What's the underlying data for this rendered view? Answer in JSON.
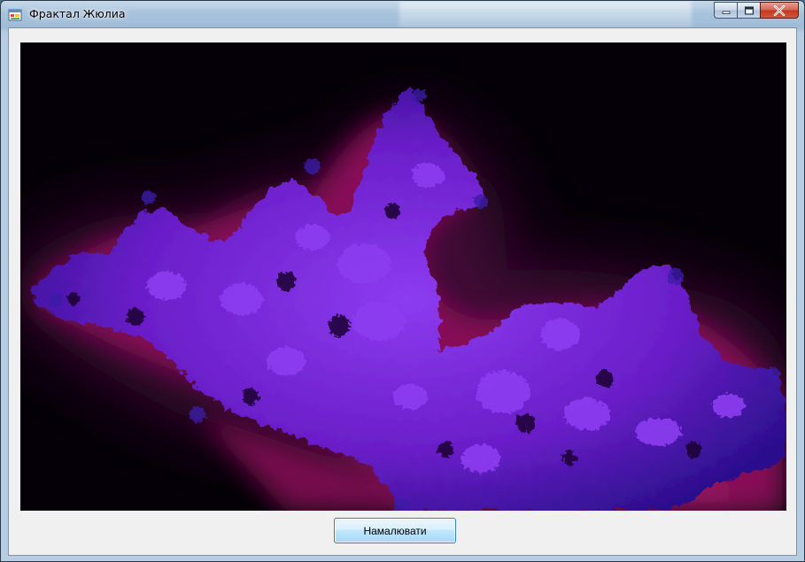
{
  "window": {
    "title": "Фрактал Жюлиа"
  },
  "icons": {
    "app": "app-window-icon",
    "minimize": "minimize-icon",
    "maximize": "maximize-icon",
    "close": "close-icon"
  },
  "canvas": {
    "background": "#050008",
    "colors": {
      "glow": "#a0105f",
      "glow_outer": "#4a0a3c",
      "body": "#6a1ec8",
      "body_light": "#8c3cf0",
      "edge": "#2a0f8c"
    }
  },
  "actions": {
    "draw_label": "Намалювати"
  }
}
